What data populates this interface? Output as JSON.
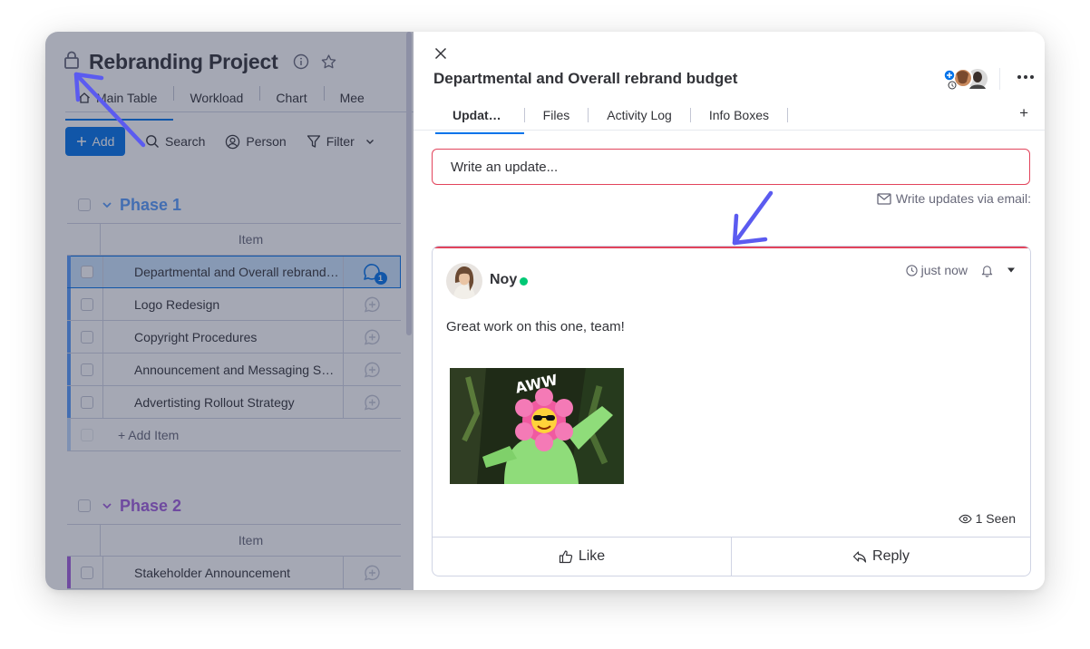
{
  "board": {
    "title": "Rebranding Project",
    "views": [
      "Main Table",
      "Workload",
      "Chart",
      "Mee"
    ],
    "toolbar": {
      "add_label": "Add",
      "search_label": "Search",
      "person_label": "Person",
      "filter_label": "Filter"
    },
    "column_item": "Item",
    "groups": [
      {
        "name": "Phase 1",
        "color": "#579bfc",
        "items": [
          "Departmental and Overall rebrand…",
          "Logo Redesign",
          "Copyright Procedures",
          "Announcement and Messaging S…",
          "Advertisting Rollout Strategy"
        ],
        "update_count": "1",
        "add_item_label": "+ Add Item"
      },
      {
        "name": "Phase 2",
        "color": "#a25ddc",
        "items": [
          "Stakeholder Announcement"
        ]
      }
    ]
  },
  "panel": {
    "title": "Departmental and Overall rebrand budget",
    "tabs": [
      "Updat…",
      "Files",
      "Activity Log",
      "Info Boxes"
    ],
    "add_tab": "+",
    "write_placeholder": "Write an update...",
    "email_hint": "Write updates via email:",
    "post": {
      "author": "Noy",
      "time": "just now",
      "text": "Great work on this one, team!",
      "gif_caption": "AWW",
      "seen": "1 Seen",
      "like_label": "Like",
      "reply_label": "Reply"
    }
  },
  "colors": {
    "primary": "#0073ea",
    "accent_red": "#e2445c",
    "online": "#00c875",
    "annotation": "#5b5bf0"
  }
}
